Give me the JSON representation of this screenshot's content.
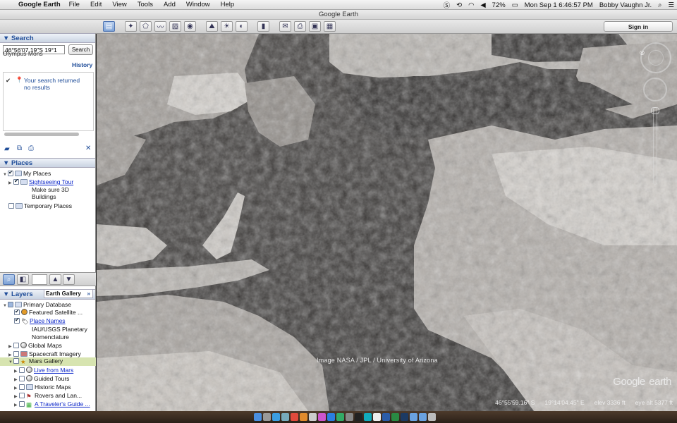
{
  "menubar": {
    "apple": "",
    "app_name": "Google Earth",
    "items": [
      "File",
      "Edit",
      "View",
      "Tools",
      "Add",
      "Window",
      "Help"
    ],
    "battery": "72%",
    "datetime": "Mon Sep 1  6:46:57 PM",
    "user": "Bobby Vaughn Jr."
  },
  "window": {
    "title": "Google Earth"
  },
  "toolbar": {
    "sign_in": "Sign in"
  },
  "search": {
    "header": "Search",
    "query": "46°56'07.19\"S 19°1",
    "button": "Search",
    "last_query": "Olympus Mons",
    "history": "History",
    "result": "Your search returned no results",
    "result_line1": "Your search returned",
    "result_line2": "no results",
    "close": "✕"
  },
  "places": {
    "header": "Places",
    "items": [
      {
        "label": "My Places"
      },
      {
        "label": "Sightseeing Tour"
      },
      {
        "label": "Make sure 3D"
      },
      {
        "label": "Buildings"
      },
      {
        "label": "Temporary Places"
      }
    ]
  },
  "layers": {
    "header": "Layers",
    "gallery_tab": "Earth Gallery",
    "gallery_arrows": "»",
    "items": [
      {
        "label": "Primary Database"
      },
      {
        "label": "Featured Satellite ..."
      },
      {
        "label": "Place Names"
      },
      {
        "label": "IAU/USGS Planetary"
      },
      {
        "label": "Nomenclature"
      },
      {
        "label": "Global Maps"
      },
      {
        "label": "Spacecraft Imagery"
      },
      {
        "label": "Mars Gallery"
      },
      {
        "label": "Live from Mars"
      },
      {
        "label": "Guided Tours"
      },
      {
        "label": "Historic Maps"
      },
      {
        "label": "Rovers and Lan..."
      },
      {
        "label": "A Traveler's Guide ..."
      }
    ]
  },
  "map": {
    "credit": "Image NASA / JPL / University of Arizona",
    "logo_main": "Google",
    "logo_sub": "earth",
    "status_lat": "46°55'59.16\" S",
    "status_lon": "19°14'04.45\" E",
    "status_elev": "elev  3336 ft",
    "status_eye": "eye alt  5377 ft"
  }
}
